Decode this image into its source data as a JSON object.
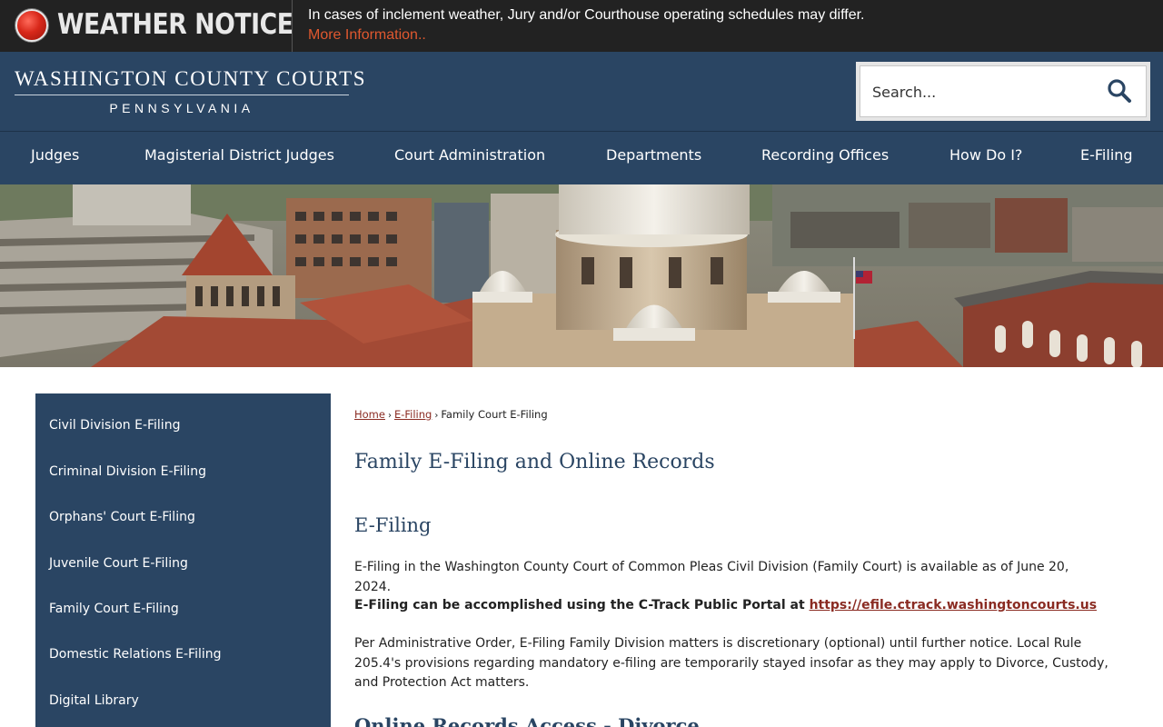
{
  "weather_notice": {
    "title": "WEATHER NOTICE",
    "message": "In cases of inclement weather, Jury and/or Courthouse operating schedules may differ.",
    "link": "More Information.."
  },
  "header": {
    "logo_line1": "WASHINGTON COUNTY COURTS",
    "logo_line2": "PENNSYLVANIA",
    "search_placeholder": "Search..."
  },
  "nav": {
    "items": [
      "Judges",
      "Magisterial District Judges",
      "Court Administration",
      "Departments",
      "Recording Offices",
      "How Do I?",
      "E-Filing"
    ]
  },
  "sidebar": {
    "items": [
      "Civil Division E-Filing",
      "Criminal Division E-Filing",
      "Orphans' Court E-Filing",
      "Juvenile Court E-Filing",
      "Family Court E-Filing",
      "Domestic Relations E-Filing",
      "Digital Library"
    ]
  },
  "breadcrumb": {
    "home": "Home",
    "sep": "›",
    "efiling": "E-Filing",
    "current": "Family Court E-Filing"
  },
  "content": {
    "page_title": "Family E-Filing and Online Records",
    "section_title": "E-Filing",
    "para1": "E-Filing in the Washington County Court of Common Pleas Civil Division (Family Court) is available as of June 20, 2024.",
    "para2_text": "E-Filing can be accomplished using the C-Track Public Portal at ",
    "para2_link": "https://efile.ctrack.washingtoncourts.us",
    "para3": "Per Administrative Order, E-Filing Family Division matters is discretionary (optional) until further notice. Local Rule 205.4's provisions regarding mandatory e-filing are temporarily stayed insofar as they may apply to Divorce, Custody, and Protection Act matters.",
    "section_title_2": "Online Records Access - Divorce"
  },
  "colors": {
    "navy": "#2a4563",
    "notice_bg": "#222222",
    "link_red": "#8a2b22",
    "notice_link": "#e0582f"
  }
}
